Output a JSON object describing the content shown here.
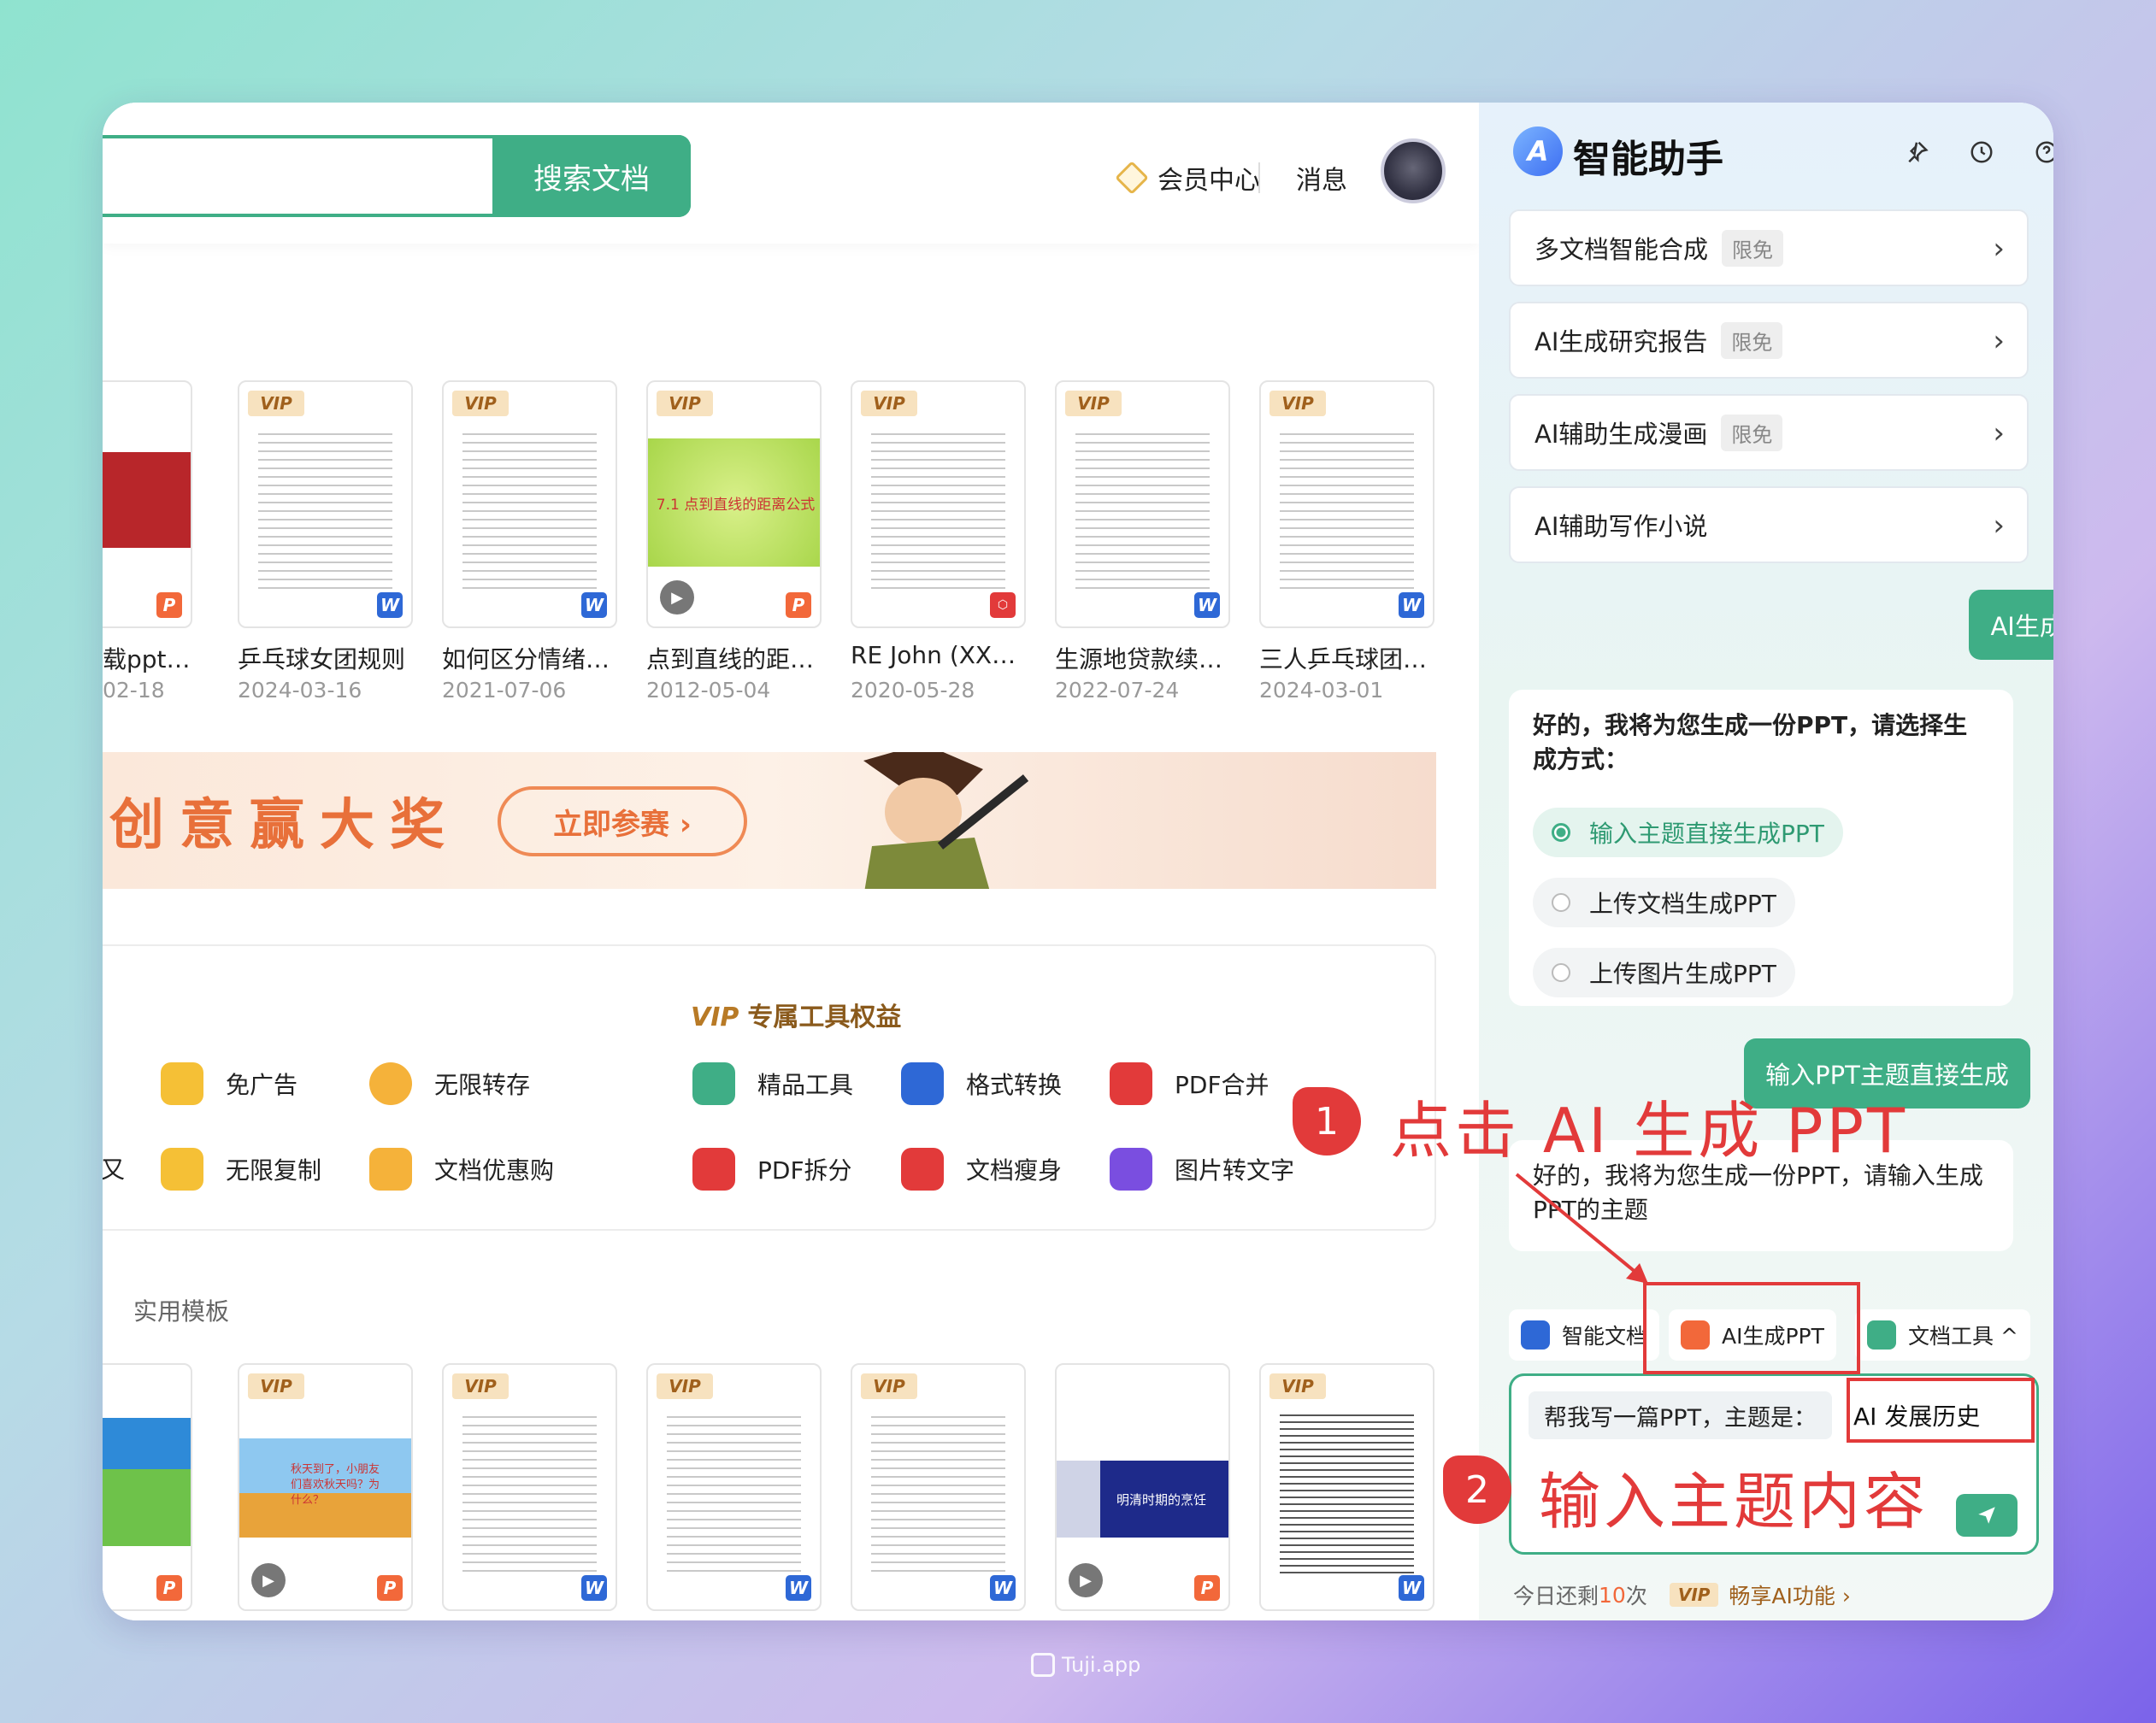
{
  "header": {
    "search_placeholder": "",
    "search_button": "搜索文档",
    "vip_center": "会员中心",
    "messages": "消息"
  },
  "recent_docs": [
    {
      "title": "载ppt…",
      "date": "02-18",
      "vip": false,
      "type": "P",
      "icon": "p-badge-icon"
    },
    {
      "title": "乒乓球女团规则",
      "date": "2024-03-16",
      "vip": true,
      "vip_label": "VIP",
      "type": "W",
      "icon": "w-badge-icon"
    },
    {
      "title": "如何区分情绪…",
      "date": "2021-07-06",
      "vip": true,
      "vip_label": "VIP",
      "type": "W",
      "icon": "w-badge-icon"
    },
    {
      "title": "点到直线的距…",
      "date": "2012-05-04",
      "vip": true,
      "vip_label": "VIP",
      "type": "P",
      "icon": "p-badge-icon",
      "slide_text": "7.1 点到直线的距离公式"
    },
    {
      "title": "RE John (XX…",
      "date": "2020-05-28",
      "vip": true,
      "vip_label": "VIP",
      "type": "PDF",
      "icon": "pdf-badge-icon"
    },
    {
      "title": "生源地贷款续…",
      "date": "2022-07-24",
      "vip": true,
      "vip_label": "VIP",
      "type": "W",
      "icon": "w-badge-icon"
    },
    {
      "title": "三人乒乓球团…",
      "date": "2024-03-01",
      "vip": true,
      "vip_label": "VIP",
      "type": "W",
      "icon": "w-badge-icon"
    }
  ],
  "banner": {
    "headline": "创意赢大奖",
    "button": "立即参赛 ›"
  },
  "vip_tools": {
    "title_badge": "VIP",
    "title": "专属工具权益",
    "items": [
      {
        "label": "免广告",
        "color": "#f5c036"
      },
      {
        "label": "无限转存",
        "color": "#f5b23a"
      },
      {
        "label": "精品工具",
        "color": "#3fae86"
      },
      {
        "label": "格式转换",
        "color": "#2e68d6"
      },
      {
        "label": "PDF合并",
        "color": "#e23a3a"
      },
      {
        "label": "无限复制",
        "color": "#f5c036"
      },
      {
        "label": "文档优惠购",
        "color": "#f5b23a"
      },
      {
        "label": "PDF拆分",
        "color": "#e23a3a"
      },
      {
        "label": "文档瘦身",
        "color": "#e23a3a"
      },
      {
        "label": "图片转文字",
        "color": "#7a4ee0"
      }
    ],
    "edge_char": "又"
  },
  "templates": {
    "label": "实用模板",
    "items": [
      {
        "type": "P",
        "vip": false
      },
      {
        "type": "P",
        "vip": true,
        "vip_label": "VIP",
        "text": "秋天到了，小朋友们喜欢秋天吗？为什么？"
      },
      {
        "type": "W",
        "vip": true,
        "vip_label": "VIP"
      },
      {
        "type": "W",
        "vip": true,
        "vip_label": "VIP"
      },
      {
        "type": "W",
        "vip": true,
        "vip_label": "VIP"
      },
      {
        "type": "P",
        "vip": false,
        "text": "明清时期的烹饪"
      },
      {
        "type": "W",
        "vip": true,
        "vip_label": "VIP"
      }
    ]
  },
  "assistant": {
    "title": "智能助手",
    "logo_letter": "A",
    "icons": [
      "pin-icon",
      "history-icon",
      "help-icon",
      "close-icon"
    ],
    "features": [
      {
        "label": "多文档智能合成",
        "tag": "限免"
      },
      {
        "label": "AI生成研究报告",
        "tag": "限免"
      },
      {
        "label": "AI辅助生成漫画",
        "tag": "限免"
      },
      {
        "label": "AI辅助写作小说",
        "tag": ""
      }
    ],
    "user_msg_1": "AI生成PPT",
    "bot_msg_1": "好的，我将为您生成一份PPT，请选择生成方式：",
    "options": [
      {
        "label": "输入主题直接生成PPT",
        "selected": true
      },
      {
        "label": "上传文档生成PPT",
        "selected": false
      },
      {
        "label": "上传图片生成PPT",
        "selected": false
      }
    ],
    "user_msg_2": "输入PPT主题直接生成",
    "bot_msg_2": "好的，我将为您生成一份PPT，请输入生成PPT的主题",
    "quick_tools": [
      {
        "label": "智能文档",
        "color": "#2e68d6"
      },
      {
        "label": "AI生成PPT",
        "color": "#f2683a"
      },
      {
        "label": "文档工具 ^",
        "color": "#3fae86"
      }
    ],
    "input_prefix": "帮我写一篇PPT，主题是：",
    "input_value": "AI 发展历史",
    "send_icon": "send-icon",
    "quota_prefix": "今日还剩",
    "quota_count": "10",
    "quota_suffix": "次",
    "quota_vip": "VIP",
    "quota_link": "畅享AI功能 ›"
  },
  "annotations": {
    "step1_num": "1",
    "step1_text": "点击 AI 生成 PPT",
    "step2_num": "2",
    "step2_text": "输入主题内容",
    "color": "#e23a3a"
  },
  "watermark": "Tuji.app"
}
